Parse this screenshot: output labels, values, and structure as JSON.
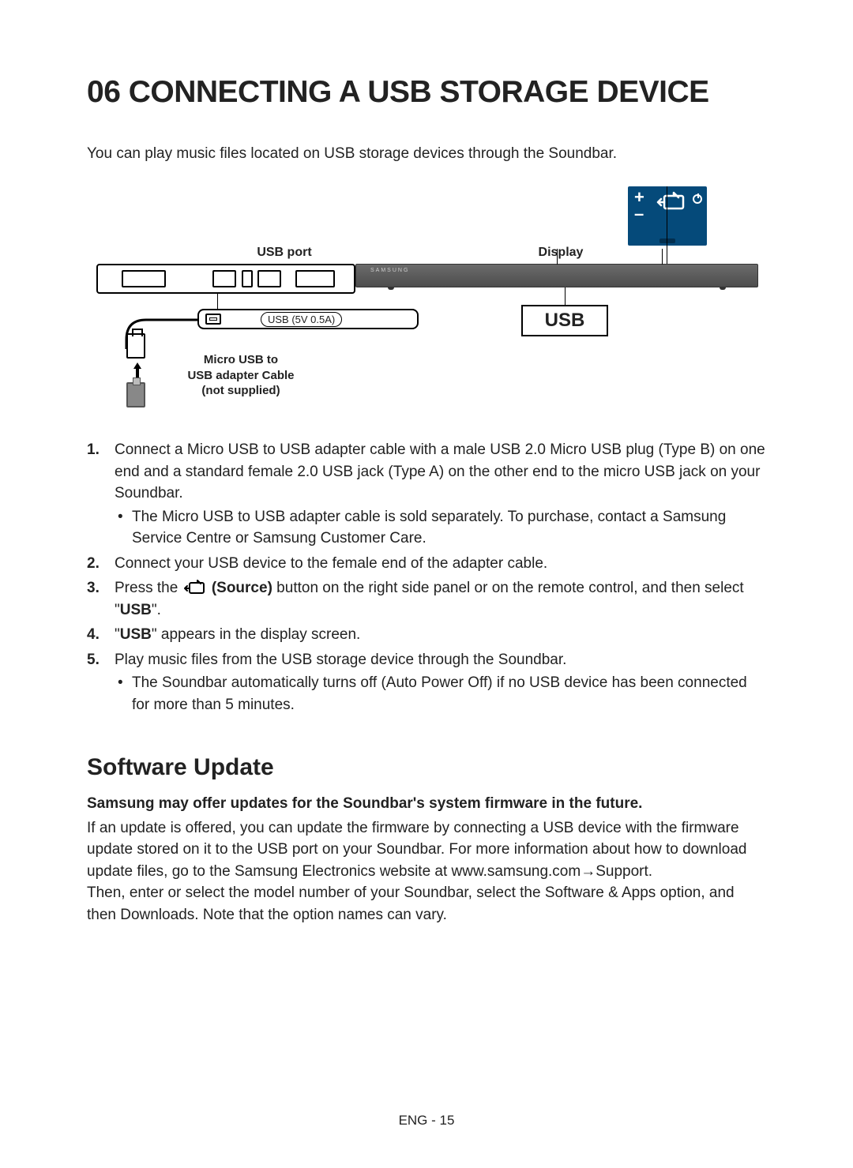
{
  "heading": "06 CONNECTING A USB STORAGE DEVICE",
  "intro": "You can play music files located on USB storage devices through the Soundbar.",
  "diagram": {
    "usb_port_label": "USB port",
    "display_label": "Display",
    "callout_port_label": "USB (5V 0.5A)",
    "cable_label_l1": "Micro USB to",
    "cable_label_l2": "USB adapter Cable",
    "cable_label_l3": "(not supplied)",
    "display_text": "USB",
    "brand": "SAMSUNG",
    "remote_plus": "+",
    "remote_minus": "–"
  },
  "steps": {
    "s1": "Connect a Micro USB to USB adapter cable with a male USB 2.0 Micro USB plug (Type B) on one end and a standard female 2.0 USB jack (Type A) on the other end to the micro USB jack on your Soundbar.",
    "s1_b1": "The Micro USB to USB adapter cable is sold separately. To purchase, contact a Samsung Service Centre or Samsung Customer Care.",
    "s2": "Connect your USB device to the female end of the adapter cable.",
    "s3_pre": "Press the ",
    "s3_source": " (Source)",
    "s3_post": " button on the right side panel or on the remote control, and then select \"",
    "s3_usb": "USB",
    "s3_end": "\".",
    "s4_pre": "\"",
    "s4_usb": "USB",
    "s4_post": "\" appears in the display screen.",
    "s5": "Play music files from the USB storage device through the Soundbar.",
    "s5_b1": "The Soundbar automatically turns off (Auto Power Off) if no USB device has been connected for more than 5 minutes."
  },
  "software": {
    "heading": "Software Update",
    "lead": "Samsung may offer updates for the Soundbar's system firmware in the future.",
    "body1": "If an update is offered, you can update the firmware by connecting a USB device with the firmware update stored on it to the USB port on your Soundbar. For more information about how to download update files, go to the Samsung Electronics website at www.samsung.com→Support.",
    "body2": "Then, enter or select the model number of your Soundbar, select the Software & Apps option, and then Downloads. Note that the option names can vary."
  },
  "footer": "ENG - 15"
}
